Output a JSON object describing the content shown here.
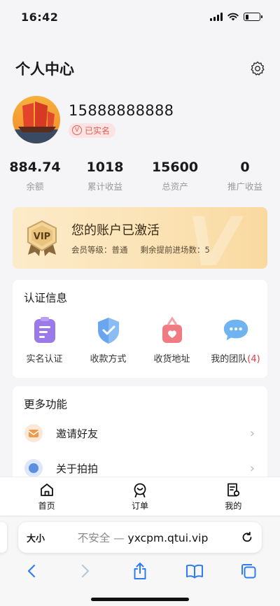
{
  "status_bar": {
    "time": "16:42",
    "battery_level": 0.25
  },
  "header": {
    "title": "个人中心"
  },
  "profile": {
    "phone": "15888888888",
    "badge": "已实名"
  },
  "stats": [
    {
      "value": "884.74",
      "label": "余额"
    },
    {
      "value": "1018",
      "label": "累计收益"
    },
    {
      "value": "15600",
      "label": "总资产"
    },
    {
      "value": "0",
      "label": "推广收益"
    }
  ],
  "vip": {
    "badge_text": "VIP",
    "title": "您的账户已激活",
    "level_label": "会员等级：普通",
    "remaining_label": "剩余提前进场数：5"
  },
  "auth": {
    "title": "认证信息",
    "items": [
      {
        "label": "实名认证",
        "icon": "id-card-icon"
      },
      {
        "label": "收款方式",
        "icon": "shield-check-icon"
      },
      {
        "label": "收货地址",
        "icon": "heart-bag-icon"
      },
      {
        "label": "我的团队",
        "count": "(4)",
        "icon": "chat-bubble-icon"
      }
    ]
  },
  "more": {
    "title": "更多功能",
    "items": [
      {
        "label": "邀请好友",
        "icon": "envelope-icon"
      },
      {
        "label": "关于拍拍",
        "icon": "info-icon"
      }
    ]
  },
  "tabbar": [
    {
      "label": "首页",
      "icon": "home-icon"
    },
    {
      "label": "订单",
      "icon": "order-icon"
    },
    {
      "label": "我的",
      "icon": "profile-doc-icon"
    }
  ],
  "browser": {
    "text_size": "大小",
    "insecure": "不安全 — ",
    "domain": "yxcpm.qtui.vip"
  },
  "colors": {
    "accent_red": "#e03c3c",
    "vip_gold": "#fbe2b4"
  }
}
